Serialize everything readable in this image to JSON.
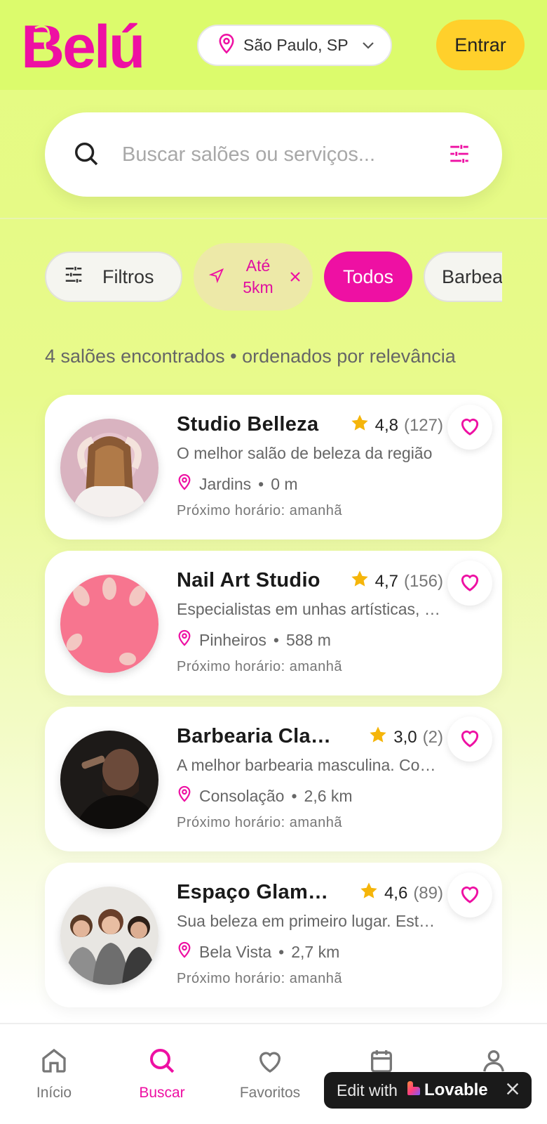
{
  "header": {
    "logo_text": "Belú",
    "location": "São Paulo, SP",
    "login_label": "Entrar"
  },
  "search": {
    "placeholder": "Buscar salões ou serviços..."
  },
  "chips": {
    "filters": "Filtros",
    "distance_line1": "Até",
    "distance_line2": "5km",
    "all": "Todos",
    "barber": "Barbearia"
  },
  "results": {
    "summary": "4 salões encontrados • ordenados por relevância"
  },
  "salons": [
    {
      "name": "Studio Belleza",
      "rating": "4,8",
      "reviews": "(127)",
      "description": "O melhor salão de beleza da região",
      "neighborhood": "Jardins",
      "distance": "0 m",
      "next_slot": "Próximo horário: amanhã"
    },
    {
      "name": "Nail Art Studio",
      "rating": "4,7",
      "reviews": "(156)",
      "description": "Especialistas em unhas artísticas, nail art",
      "neighborhood": "Pinheiros",
      "distance": "588 m",
      "next_slot": "Próximo horário: amanhã"
    },
    {
      "name": "Barbearia Classic",
      "rating": "3,0",
      "reviews": "(2)",
      "description": "A melhor barbearia masculina. Cortes",
      "neighborhood": "Consolação",
      "distance": "2,6 km",
      "next_slot": "Próximo horário: amanhã"
    },
    {
      "name": "Espaço Glamour",
      "rating": "4,6",
      "reviews": "(89)",
      "description": "Sua beleza em primeiro lugar. Estética",
      "neighborhood": "Bela Vista",
      "distance": "2,7 km",
      "next_slot": "Próximo horário: amanhã"
    }
  ],
  "nav": {
    "home": "Início",
    "search": "Buscar",
    "favorites": "Favoritos",
    "bookings": "Agenda",
    "profile": "Perfil"
  },
  "lovable_badge": {
    "prefix": "Edit with",
    "brand": "Lovable"
  },
  "colors": {
    "brand_pink": "#ee10a3",
    "accent_yellow": "#ffd02b",
    "header_lime": "#dcfb6c",
    "star": "#f5b50a"
  },
  "icons": {
    "location": "map-pin-icon",
    "search": "search-icon",
    "filters": "sliders-icon",
    "favorite": "heart-icon",
    "rating": "star-icon"
  }
}
